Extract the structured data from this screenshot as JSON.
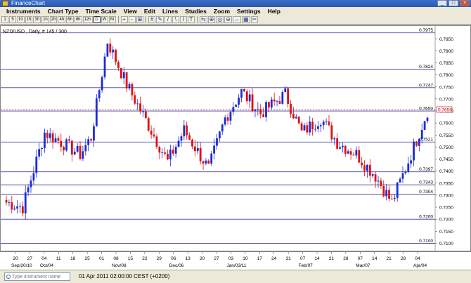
{
  "window": {
    "title": "FinanceChart",
    "controls": [
      "_",
      "□",
      "×"
    ]
  },
  "menu": [
    "Instruments",
    "Chart Type",
    "Time Scale",
    "View",
    "Edit",
    "Lines",
    "Studies",
    "Zoom",
    "Settings",
    "Help"
  ],
  "toolbar": [
    "1",
    "5",
    "10",
    "15",
    "30",
    "1h",
    "2h",
    "4h",
    "6h",
    "8h",
    "12h",
    "D",
    "W",
    "M",
    "+",
    "-",
    "⊞",
    "#",
    "✎",
    "/",
    "\\",
    "⌇",
    "T",
    "⇆",
    "⊕",
    "◎",
    "⊖",
    "↔",
    "▦",
    "✂"
  ],
  "chart": {
    "instrument_label": "NZD/USD , Daily, # 145 / 300",
    "price_axis": {
      "ticks": [
        "0.7950",
        "0.7900",
        "0.7850",
        "0.7800",
        "0.7750",
        "0.7700",
        "0.7650",
        "0.7600",
        "0.7550",
        "0.7500",
        "0.7450",
        "0.7400",
        "0.7350",
        "0.7300",
        "0.7250",
        "0.7200",
        "0.7150",
        "0.7100"
      ]
    },
    "levels": [
      {
        "label": "0.7975",
        "value": 0.7975
      },
      {
        "label": "0.7824",
        "value": 0.7824
      },
      {
        "label": "0.7747",
        "value": 0.7747
      },
      {
        "label": "0.7650",
        "value": 0.765
      },
      {
        "label": "0.7521",
        "value": 0.7521
      },
      {
        "label": "0.7397",
        "value": 0.7397
      },
      {
        "label": "0.7343",
        "value": 0.7343
      },
      {
        "label": "0.7304",
        "value": 0.7304
      },
      {
        "label": "0.7200",
        "value": 0.72
      },
      {
        "label": "0.7100",
        "value": 0.71
      }
    ],
    "current_price": {
      "label": "0.7656",
      "value": 0.7656
    },
    "colors": {
      "up": "#1d2bd8",
      "down": "#e01010",
      "level": "#3c3ca0",
      "current": "#c00000"
    }
  },
  "x_axis": {
    "day_ticks": [
      "20",
      "27",
      "04",
      "11",
      "18",
      "25",
      "01",
      "08",
      "15",
      "22",
      "29",
      "06",
      "13",
      "20",
      "27",
      "03",
      "10",
      "17",
      "24",
      "31",
      "07",
      "14",
      "21",
      "28",
      "07",
      "14",
      "21",
      "28",
      "04"
    ],
    "month_labels": [
      "Sep/20/10",
      "Oct/04",
      "Nov/08",
      "Dec/06",
      "Jan/03/11",
      "Feb/07",
      "Mar/07",
      "Apr/04"
    ]
  },
  "status": {
    "instrument_placeholder": "Type instrument name",
    "datetime": "01 Apr 2011 02:00:00  CEST (+0200)"
  }
}
